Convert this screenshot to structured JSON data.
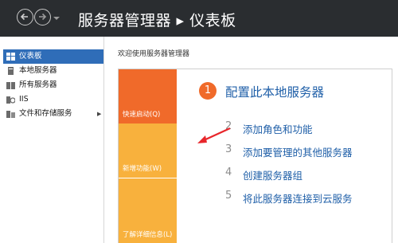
{
  "titlebar": {
    "title": "服务器管理器 ▸ 仪表板",
    "back_icon": "arrow-left-icon",
    "forward_icon": "arrow-right-icon",
    "dropdown_icon": "chevron-down-icon"
  },
  "sidebar": {
    "items": [
      {
        "label": "仪表板",
        "icon": "dashboard-icon",
        "active": true
      },
      {
        "label": "本地服务器",
        "icon": "server-icon",
        "active": false
      },
      {
        "label": "所有服务器",
        "icon": "servers-icon",
        "active": false
      },
      {
        "label": "IIS",
        "icon": "iis-icon",
        "active": false
      },
      {
        "label": "文件和存储服务",
        "icon": "storage-icon",
        "active": false,
        "expandable": true
      }
    ]
  },
  "main": {
    "welcome": "欢迎使用服务器管理器",
    "tiles": [
      {
        "label": "快速启动(Q)",
        "color": "#f06a2a"
      },
      {
        "label": "新增功能(W)",
        "color": "#f8b13d"
      },
      {
        "label": "了解详细信息(L)",
        "color": "#f8b13d"
      }
    ],
    "primary_step": {
      "number": "1",
      "label": "配置此本地服务器"
    },
    "steps": [
      {
        "number": "2",
        "label": "添加角色和功能"
      },
      {
        "number": "3",
        "label": "添加要管理的其他服务器"
      },
      {
        "number": "4",
        "label": "创建服务器组"
      },
      {
        "number": "5",
        "label": "将此服务器连接到云服务"
      }
    ]
  },
  "colors": {
    "titlebar_bg": "#2a2d30",
    "accent_orange": "#f06a2a",
    "accent_yellow": "#f8b13d",
    "link_blue": "#1f5fa8",
    "selection_blue": "#2f6db8",
    "annotation_red": "#e8262b"
  }
}
